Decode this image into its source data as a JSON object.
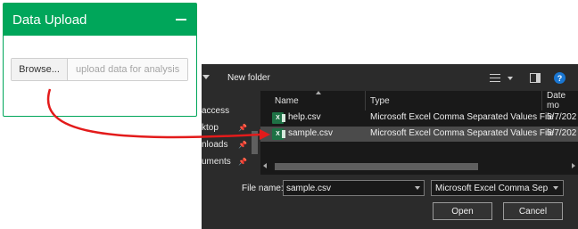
{
  "panel": {
    "title": "Data Upload",
    "browse_label": "Browse...",
    "file_placeholder": "upload data for analysis",
    "accent_color": "#00a65a"
  },
  "dialog": {
    "toolbar": {
      "new_folder_label": "New folder",
      "help_label": "?"
    },
    "nav_items": [
      "access",
      "ktop",
      "nloads",
      "uments"
    ],
    "columns": {
      "name": "Name",
      "type": "Type",
      "date": "Date mo"
    },
    "files": [
      {
        "name": "help.csv",
        "type": "Microsoft Excel Comma Separated Values File",
        "date": "5/7/202"
      },
      {
        "name": "sample.csv",
        "type": "Microsoft Excel Comma Separated Values File",
        "date": "5/7/202",
        "selected": true
      }
    ],
    "file_name_label": "File name:",
    "file_name_value": "sample.csv",
    "file_type_value": "Microsoft Excel Comma Separa",
    "open_label": "Open",
    "cancel_label": "Cancel"
  },
  "annotation": {
    "arrow_color": "#e31b1b"
  }
}
